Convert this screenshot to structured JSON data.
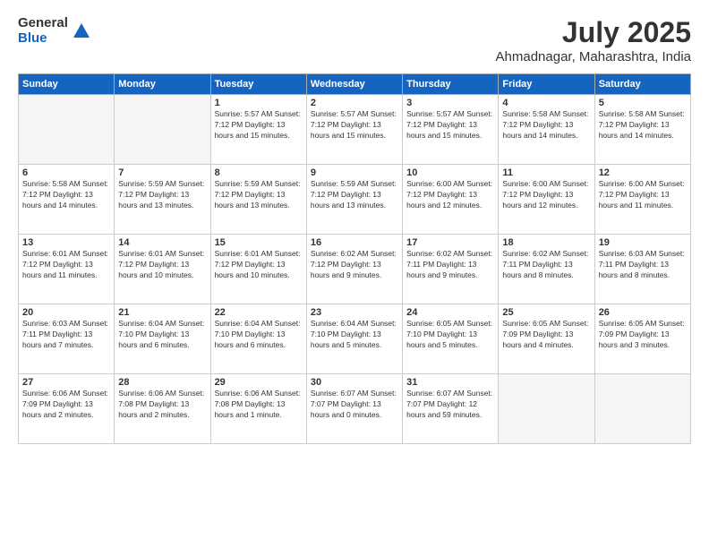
{
  "logo": {
    "general": "General",
    "blue": "Blue"
  },
  "title": "July 2025",
  "subtitle": "Ahmadnagar, Maharashtra, India",
  "headers": [
    "Sunday",
    "Monday",
    "Tuesday",
    "Wednesday",
    "Thursday",
    "Friday",
    "Saturday"
  ],
  "weeks": [
    [
      {
        "day": "",
        "info": ""
      },
      {
        "day": "",
        "info": ""
      },
      {
        "day": "1",
        "info": "Sunrise: 5:57 AM\nSunset: 7:12 PM\nDaylight: 13 hours\nand 15 minutes."
      },
      {
        "day": "2",
        "info": "Sunrise: 5:57 AM\nSunset: 7:12 PM\nDaylight: 13 hours\nand 15 minutes."
      },
      {
        "day": "3",
        "info": "Sunrise: 5:57 AM\nSunset: 7:12 PM\nDaylight: 13 hours\nand 15 minutes."
      },
      {
        "day": "4",
        "info": "Sunrise: 5:58 AM\nSunset: 7:12 PM\nDaylight: 13 hours\nand 14 minutes."
      },
      {
        "day": "5",
        "info": "Sunrise: 5:58 AM\nSunset: 7:12 PM\nDaylight: 13 hours\nand 14 minutes."
      }
    ],
    [
      {
        "day": "6",
        "info": "Sunrise: 5:58 AM\nSunset: 7:12 PM\nDaylight: 13 hours\nand 14 minutes."
      },
      {
        "day": "7",
        "info": "Sunrise: 5:59 AM\nSunset: 7:12 PM\nDaylight: 13 hours\nand 13 minutes."
      },
      {
        "day": "8",
        "info": "Sunrise: 5:59 AM\nSunset: 7:12 PM\nDaylight: 13 hours\nand 13 minutes."
      },
      {
        "day": "9",
        "info": "Sunrise: 5:59 AM\nSunset: 7:12 PM\nDaylight: 13 hours\nand 13 minutes."
      },
      {
        "day": "10",
        "info": "Sunrise: 6:00 AM\nSunset: 7:12 PM\nDaylight: 13 hours\nand 12 minutes."
      },
      {
        "day": "11",
        "info": "Sunrise: 6:00 AM\nSunset: 7:12 PM\nDaylight: 13 hours\nand 12 minutes."
      },
      {
        "day": "12",
        "info": "Sunrise: 6:00 AM\nSunset: 7:12 PM\nDaylight: 13 hours\nand 11 minutes."
      }
    ],
    [
      {
        "day": "13",
        "info": "Sunrise: 6:01 AM\nSunset: 7:12 PM\nDaylight: 13 hours\nand 11 minutes."
      },
      {
        "day": "14",
        "info": "Sunrise: 6:01 AM\nSunset: 7:12 PM\nDaylight: 13 hours\nand 10 minutes."
      },
      {
        "day": "15",
        "info": "Sunrise: 6:01 AM\nSunset: 7:12 PM\nDaylight: 13 hours\nand 10 minutes."
      },
      {
        "day": "16",
        "info": "Sunrise: 6:02 AM\nSunset: 7:12 PM\nDaylight: 13 hours\nand 9 minutes."
      },
      {
        "day": "17",
        "info": "Sunrise: 6:02 AM\nSunset: 7:11 PM\nDaylight: 13 hours\nand 9 minutes."
      },
      {
        "day": "18",
        "info": "Sunrise: 6:02 AM\nSunset: 7:11 PM\nDaylight: 13 hours\nand 8 minutes."
      },
      {
        "day": "19",
        "info": "Sunrise: 6:03 AM\nSunset: 7:11 PM\nDaylight: 13 hours\nand 8 minutes."
      }
    ],
    [
      {
        "day": "20",
        "info": "Sunrise: 6:03 AM\nSunset: 7:11 PM\nDaylight: 13 hours\nand 7 minutes."
      },
      {
        "day": "21",
        "info": "Sunrise: 6:04 AM\nSunset: 7:10 PM\nDaylight: 13 hours\nand 6 minutes."
      },
      {
        "day": "22",
        "info": "Sunrise: 6:04 AM\nSunset: 7:10 PM\nDaylight: 13 hours\nand 6 minutes."
      },
      {
        "day": "23",
        "info": "Sunrise: 6:04 AM\nSunset: 7:10 PM\nDaylight: 13 hours\nand 5 minutes."
      },
      {
        "day": "24",
        "info": "Sunrise: 6:05 AM\nSunset: 7:10 PM\nDaylight: 13 hours\nand 5 minutes."
      },
      {
        "day": "25",
        "info": "Sunrise: 6:05 AM\nSunset: 7:09 PM\nDaylight: 13 hours\nand 4 minutes."
      },
      {
        "day": "26",
        "info": "Sunrise: 6:05 AM\nSunset: 7:09 PM\nDaylight: 13 hours\nand 3 minutes."
      }
    ],
    [
      {
        "day": "27",
        "info": "Sunrise: 6:06 AM\nSunset: 7:09 PM\nDaylight: 13 hours\nand 2 minutes."
      },
      {
        "day": "28",
        "info": "Sunrise: 6:06 AM\nSunset: 7:08 PM\nDaylight: 13 hours\nand 2 minutes."
      },
      {
        "day": "29",
        "info": "Sunrise: 6:06 AM\nSunset: 7:08 PM\nDaylight: 13 hours\nand 1 minute."
      },
      {
        "day": "30",
        "info": "Sunrise: 6:07 AM\nSunset: 7:07 PM\nDaylight: 13 hours\nand 0 minutes."
      },
      {
        "day": "31",
        "info": "Sunrise: 6:07 AM\nSunset: 7:07 PM\nDaylight: 12 hours\nand 59 minutes."
      },
      {
        "day": "",
        "info": ""
      },
      {
        "day": "",
        "info": ""
      }
    ]
  ]
}
